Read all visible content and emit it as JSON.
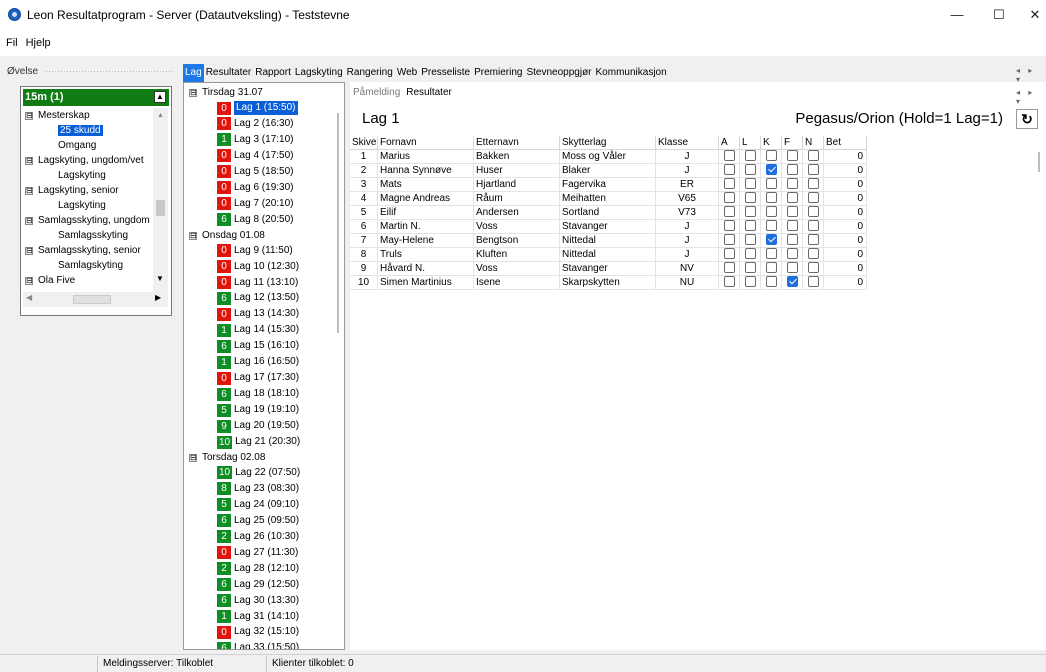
{
  "window": {
    "title": "Leon Resultatprogram - Server (Datautveksling) - Teststevne",
    "controls": {
      "minimize": "—",
      "maximize": "☐",
      "close": "✕"
    }
  },
  "menu": [
    "Fil",
    "Hjelp"
  ],
  "left": {
    "label": "Øvelse",
    "header": "15m (1)",
    "header_button": "▲",
    "tree": [
      {
        "text": "Mesterskap",
        "level": 0,
        "expander": "⊟"
      },
      {
        "text": "25 skudd",
        "level": 1,
        "selected": true
      },
      {
        "text": "Omgang",
        "level": 1
      },
      {
        "text": "Lagskyting, ungdom/vet",
        "level": 0,
        "expander": "⊟"
      },
      {
        "text": "Lagskyting",
        "level": 1
      },
      {
        "text": "Lagskyting, senior",
        "level": 0,
        "expander": "⊟"
      },
      {
        "text": "Lagskyting",
        "level": 1
      },
      {
        "text": "Samlagsskyting, ungdom",
        "level": 0,
        "expander": "⊟"
      },
      {
        "text": "Samlagsskyting",
        "level": 1
      },
      {
        "text": "Samlagsskyting, senior",
        "level": 0,
        "expander": "⊟"
      },
      {
        "text": "Samlagskyting",
        "level": 1
      },
      {
        "text": "Ola Five",
        "level": 0,
        "expander": "⊟"
      }
    ],
    "scroll": {
      "up": "▲",
      "down": "▼",
      "left": "◀",
      "right": "▶",
      "grip": "|||"
    }
  },
  "main_tabs": [
    "Lag",
    "Resultater",
    "Rapport",
    "Lagskyting",
    "Rangering",
    "Web",
    "Presseliste",
    "Premiering",
    "Stevneoppgjør",
    "Kommunikasjon"
  ],
  "tab_arrows": "◂ ▸ ▾",
  "lag_tree": [
    {
      "day": "Tirsdag 31.07",
      "expander": "⊟",
      "items": [
        {
          "badge": "0",
          "color": "red",
          "label": "Lag 1 (15:50)",
          "selected": true
        },
        {
          "badge": "0",
          "color": "red",
          "label": "Lag 2 (16:30)"
        },
        {
          "badge": "1",
          "color": "green",
          "label": "Lag 3 (17:10)"
        },
        {
          "badge": "0",
          "color": "red",
          "label": "Lag 4 (17:50)"
        },
        {
          "badge": "0",
          "color": "red",
          "label": "Lag 5 (18:50)"
        },
        {
          "badge": "0",
          "color": "red",
          "label": "Lag 6 (19:30)"
        },
        {
          "badge": "0",
          "color": "red",
          "label": "Lag 7 (20:10)"
        },
        {
          "badge": "6",
          "color": "green",
          "label": "Lag 8 (20:50)"
        }
      ]
    },
    {
      "day": "Onsdag 01.08",
      "expander": "⊟",
      "items": [
        {
          "badge": "0",
          "color": "red",
          "label": "Lag 9 (11:50)"
        },
        {
          "badge": "0",
          "color": "red",
          "label": "Lag 10 (12:30)"
        },
        {
          "badge": "0",
          "color": "red",
          "label": "Lag 11 (13:10)"
        },
        {
          "badge": "6",
          "color": "green",
          "label": "Lag 12 (13:50)"
        },
        {
          "badge": "0",
          "color": "red",
          "label": "Lag 13 (14:30)"
        },
        {
          "badge": "1",
          "color": "green",
          "label": "Lag 14 (15:30)"
        },
        {
          "badge": "6",
          "color": "green",
          "label": "Lag 15 (16:10)"
        },
        {
          "badge": "1",
          "color": "green",
          "label": "Lag 16 (16:50)"
        },
        {
          "badge": "0",
          "color": "red",
          "label": "Lag 17 (17:30)"
        },
        {
          "badge": "6",
          "color": "green",
          "label": "Lag 18 (18:10)"
        },
        {
          "badge": "5",
          "color": "green",
          "label": "Lag 19 (19:10)"
        },
        {
          "badge": "9",
          "color": "green",
          "label": "Lag 20 (19:50)"
        },
        {
          "badge": "10",
          "color": "green",
          "label": "Lag 21 (20:30)"
        }
      ]
    },
    {
      "day": "Torsdag 02.08",
      "expander": "⊟",
      "items": [
        {
          "badge": "10",
          "color": "green",
          "label": "Lag 22 (07:50)"
        },
        {
          "badge": "8",
          "color": "green",
          "label": "Lag 23 (08:30)"
        },
        {
          "badge": "5",
          "color": "green",
          "label": "Lag 24 (09:10)"
        },
        {
          "badge": "6",
          "color": "green",
          "label": "Lag 25 (09:50)"
        },
        {
          "badge": "2",
          "color": "green",
          "label": "Lag 26 (10:30)"
        },
        {
          "badge": "0",
          "color": "red",
          "label": "Lag 27 (11:30)"
        },
        {
          "badge": "2",
          "color": "green",
          "label": "Lag 28 (12:10)"
        },
        {
          "badge": "6",
          "color": "green",
          "label": "Lag 29 (12:50)"
        },
        {
          "badge": "6",
          "color": "green",
          "label": "Lag 30 (13:30)"
        },
        {
          "badge": "1",
          "color": "green",
          "label": "Lag 31 (14:10)"
        },
        {
          "badge": "0",
          "color": "red",
          "label": "Lag 32 (15:10)"
        },
        {
          "badge": "6",
          "color": "green",
          "label": "Lag 33 (15:50)"
        }
      ]
    }
  ],
  "right": {
    "sub_tabs": [
      "Påmelding",
      "Resultater"
    ],
    "sub_arrows": "◂ ▸ ▾",
    "title": "Lag 1",
    "info": "Pegasus/Orion (Hold=1 Lag=1)",
    "refresh_icon": "↻",
    "columns": [
      "Skivenr",
      "Fornavn",
      "Etternavn",
      "Skytterlag",
      "Klasse",
      "A",
      "L",
      "K",
      "F",
      "N",
      "Bet"
    ],
    "rows": [
      {
        "skive": "1",
        "fornavn": "Marius",
        "etternavn": "Bakken",
        "lag": "Moss og Våler",
        "klasse": "J",
        "checks": [
          false,
          false,
          false,
          false,
          false
        ],
        "bet": "0"
      },
      {
        "skive": "2",
        "fornavn": "Hanna Synnøve",
        "etternavn": "Huser",
        "lag": "Blaker",
        "klasse": "J",
        "checks": [
          false,
          false,
          true,
          false,
          false
        ],
        "bet": "0"
      },
      {
        "skive": "3",
        "fornavn": "Mats",
        "etternavn": "Hjartland",
        "lag": "Fagervika",
        "klasse": "ER",
        "checks": [
          false,
          false,
          false,
          false,
          false
        ],
        "bet": "0"
      },
      {
        "skive": "4",
        "fornavn": "Magne Andreas",
        "etternavn": "Råum",
        "lag": "Meihatten",
        "klasse": "V65",
        "checks": [
          false,
          false,
          false,
          false,
          false
        ],
        "bet": "0"
      },
      {
        "skive": "5",
        "fornavn": "Eilif",
        "etternavn": "Andersen",
        "lag": "Sortland",
        "klasse": "V73",
        "checks": [
          false,
          false,
          false,
          false,
          false
        ],
        "bet": "0"
      },
      {
        "skive": "6",
        "fornavn": "Martin N.",
        "etternavn": "Voss",
        "lag": "Stavanger",
        "klasse": "J",
        "checks": [
          false,
          false,
          false,
          false,
          false
        ],
        "bet": "0"
      },
      {
        "skive": "7",
        "fornavn": "May-Helene",
        "etternavn": "Bengtson",
        "lag": "Nittedal",
        "klasse": "J",
        "checks": [
          false,
          false,
          true,
          false,
          false
        ],
        "bet": "0"
      },
      {
        "skive": "8",
        "fornavn": "Truls",
        "etternavn": "Kluften",
        "lag": "Nittedal",
        "klasse": "J",
        "checks": [
          false,
          false,
          false,
          false,
          false
        ],
        "bet": "0"
      },
      {
        "skive": "9",
        "fornavn": "Håvard N.",
        "etternavn": "Voss",
        "lag": "Stavanger",
        "klasse": "NV",
        "checks": [
          false,
          false,
          false,
          false,
          false
        ],
        "bet": "0"
      },
      {
        "skive": "10",
        "fornavn": "Simen Martinius",
        "etternavn": "Isene",
        "lag": "Skarpskytten",
        "klasse": "NU",
        "checks": [
          false,
          false,
          false,
          true,
          false
        ],
        "bet": "0"
      }
    ]
  },
  "status": [
    "Meldingsserver: Tilkoblet",
    "Klienter tilkoblet: 0"
  ],
  "colors": {
    "badge_red": "#e0150e",
    "badge_green": "#108e26",
    "selection": "#0a5fd8",
    "header_green": "#0f7d14",
    "tab_active": "#1e78e6"
  }
}
